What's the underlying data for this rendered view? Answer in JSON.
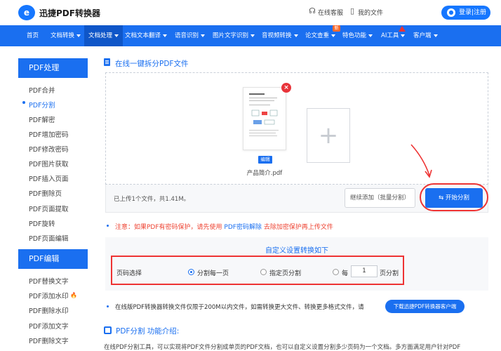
{
  "header": {
    "brand": "迅捷PDF转换器",
    "service_label": "在线客服",
    "myfiles_label": "我的文件",
    "login_label": "登录|注册"
  },
  "nav": {
    "items": [
      {
        "label": "首页",
        "caret": false
      },
      {
        "label": "文档转换",
        "caret": true
      },
      {
        "label": "文档处理",
        "caret": true
      },
      {
        "label": "文档文本翻译",
        "caret": true
      },
      {
        "label": "语音识别",
        "caret": true
      },
      {
        "label": "图片文字识别",
        "caret": true
      },
      {
        "label": "音视频转换",
        "caret": true
      },
      {
        "label": "论文查重",
        "caret": true
      },
      {
        "label": "特色功能",
        "caret": true
      },
      {
        "label": "AI工具",
        "caret": true
      },
      {
        "label": "客户端",
        "caret": true
      }
    ],
    "new_badge": "新"
  },
  "sidebar": {
    "section1_title": "PDF处理",
    "section1_items": [
      "PDF合并",
      "PDF分割",
      "PDF解密",
      "PDF增加密码",
      "PDF修改密码",
      "PDF图片获取",
      "PDF插入页面",
      "PDF删除页",
      "PDF页面提取",
      "PDF旋转",
      "PDF页面编辑"
    ],
    "section2_title": "PDF编辑",
    "section2_items": [
      "PDF替换文字",
      "PDF添加水印",
      "PDF删除水印",
      "PDF添加文字",
      "PDF删除文字"
    ]
  },
  "main": {
    "title": "在线一键拆分PDF文件",
    "file_name": "产品简介.pdf",
    "edit_label": "编辑",
    "upload_status": "已上传1个文件，共1.41M。",
    "continue_label": "继续添加（批量分割）",
    "start_label": "开始分割",
    "note_prefix": "注意：如果PDF有密码保护，请先使用",
    "note_link": "PDF密码解除",
    "note_suffix": "去除加密保护再上传文件",
    "settings_title": "自定义设置转换如下",
    "page_select_label": "页码选择",
    "opt_each": "分割每一页",
    "opt_specified": "指定页分割",
    "opt_every_prefix": "每",
    "opt_every_value": "1",
    "opt_every_suffix": "页分割",
    "tip": "在线版PDF转换器转换文件仅限于200M以内文件，如需转换更大文件、转换更多格式文件，请",
    "download_label": "下载迅捷PDF转换器客户端",
    "intro_title": "PDF分割 功能介绍:",
    "intro_text": "在线PDF分割工具，可以实现将PDF文件分割成单页的PDF文档，也可以自定义设置分割多少页码为一个文档。多方面满足用户针对PDF"
  },
  "colors": {
    "brand_blue": "#1a6ff0",
    "highlight_red": "#e33",
    "nav_active": "#0f56c8"
  }
}
